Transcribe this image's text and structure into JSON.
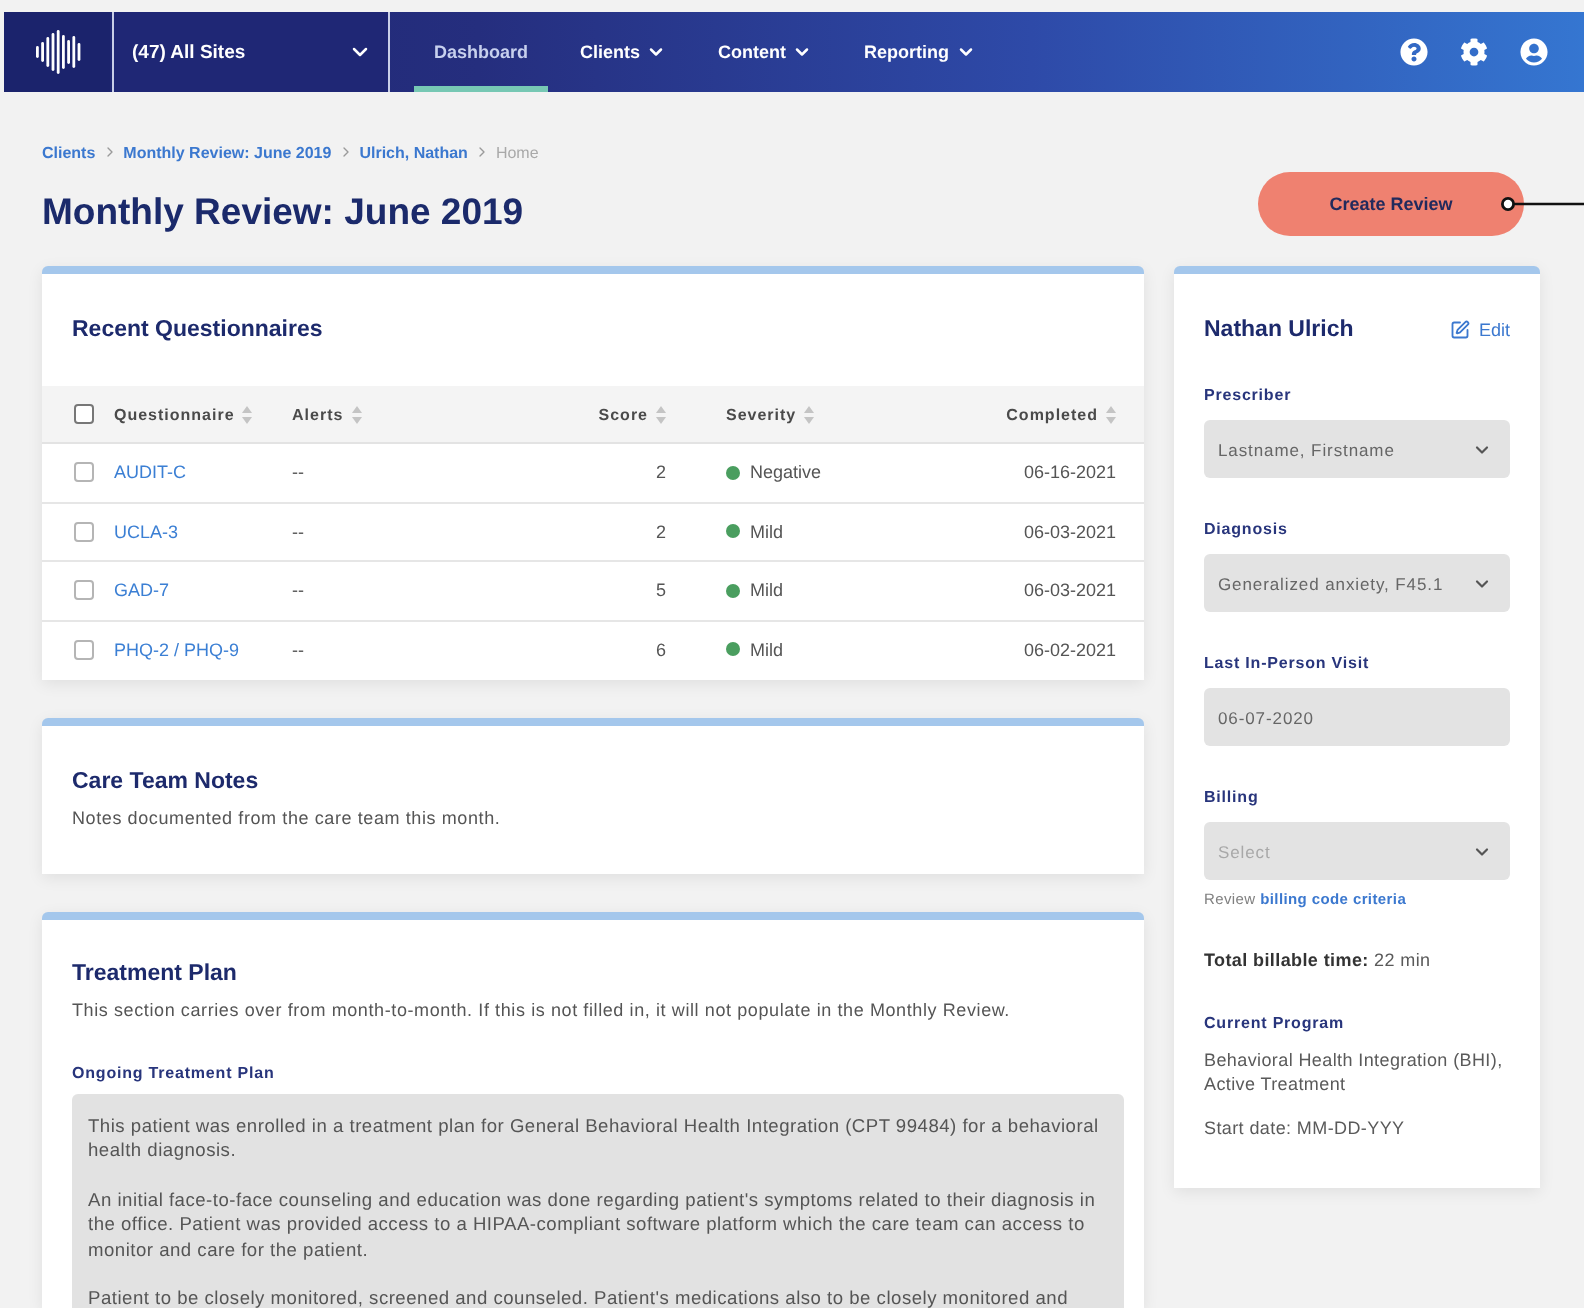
{
  "nav": {
    "site_selector": {
      "label": "(47) All Sites"
    },
    "items": [
      {
        "label": "Dashboard",
        "selected": true,
        "has_menu": false
      },
      {
        "label": "Clients",
        "selected": false,
        "has_menu": true
      },
      {
        "label": "Content",
        "selected": false,
        "has_menu": true
      },
      {
        "label": "Reporting",
        "selected": false,
        "has_menu": true
      }
    ]
  },
  "breadcrumb": [
    {
      "label": "Clients",
      "current": false
    },
    {
      "label": "Monthly Review: June 2019",
      "current": false
    },
    {
      "label": "Ulrich, Nathan",
      "current": false
    },
    {
      "label": "Home",
      "current": true
    }
  ],
  "page_title": "Monthly Review: June 2019",
  "create_button": {
    "label": "Create Review"
  },
  "questionnaires": {
    "title": "Recent Questionnaires",
    "select_all": {
      "checked": false
    },
    "columns": [
      "Questionnaire",
      "Alerts",
      "Score",
      "Severity",
      "Completed"
    ],
    "rows": [
      {
        "checked": false,
        "questionnaire": "AUDIT-C",
        "alerts": "--",
        "score": "2",
        "severity": {
          "label": "Negative",
          "color": "#4a9e5f"
        },
        "completed": "06-16-2021"
      },
      {
        "checked": false,
        "questionnaire": "UCLA-3",
        "alerts": "--",
        "score": "2",
        "severity": {
          "label": "Mild",
          "color": "#4a9e5f"
        },
        "completed": "06-03-2021"
      },
      {
        "checked": false,
        "questionnaire": "GAD-7",
        "alerts": "--",
        "score": "5",
        "severity": {
          "label": "Mild",
          "color": "#4a9e5f"
        },
        "completed": "06-03-2021"
      },
      {
        "checked": false,
        "questionnaire": "PHQ-2 / PHQ-9",
        "alerts": "--",
        "score": "6",
        "severity": {
          "label": "Mild",
          "color": "#4a9e5f"
        },
        "completed": "06-02-2021"
      }
    ]
  },
  "care_team_notes": {
    "title": "Care Team Notes",
    "description": "Notes documented from the care team this month."
  },
  "treatment_plan": {
    "title": "Treatment Plan",
    "description": "This section carries over from month-to-month. If this is not filled in, it will not populate in the Monthly Review.",
    "field_label": "Ongoing Treatment Plan",
    "paragraphs": [
      "This patient was enrolled in a treatment plan for General Behavioral Health Integration (CPT 99484) for a behavioral health diagnosis.",
      "An initial face-to-face counseling and education was done regarding patient's symptoms related to their diagnosis in the office. Patient was provided access to a HIPAA-compliant software platform which the care team can access to monitor and care for the patient.",
      "Patient to be closely monitored, screened and counseled. Patient's medications also to be closely monitored and"
    ]
  },
  "patient": {
    "name": "Nathan Ulrich",
    "edit": "Edit",
    "fields": [
      {
        "kind": "select",
        "label": "Prescriber",
        "value": "Lastname, Firstname"
      },
      {
        "kind": "select",
        "label": "Diagnosis",
        "value": "Generalized anxiety, F45.1"
      },
      {
        "kind": "date",
        "label": "Last In-Person Visit",
        "value": "06-07-2020"
      },
      {
        "kind": "select",
        "label": "Billing",
        "placeholder": "Select",
        "hint": {
          "text": "Review",
          "link": "billing code criteria"
        }
      }
    ],
    "billable_time": "**Total billable time:** 22 min",
    "program": {
      "label": "Current Program",
      "description": "Behavioral Health Integration (BHI), Active Treatment",
      "start_date": "Start date: MM-DD-YYY"
    }
  }
}
